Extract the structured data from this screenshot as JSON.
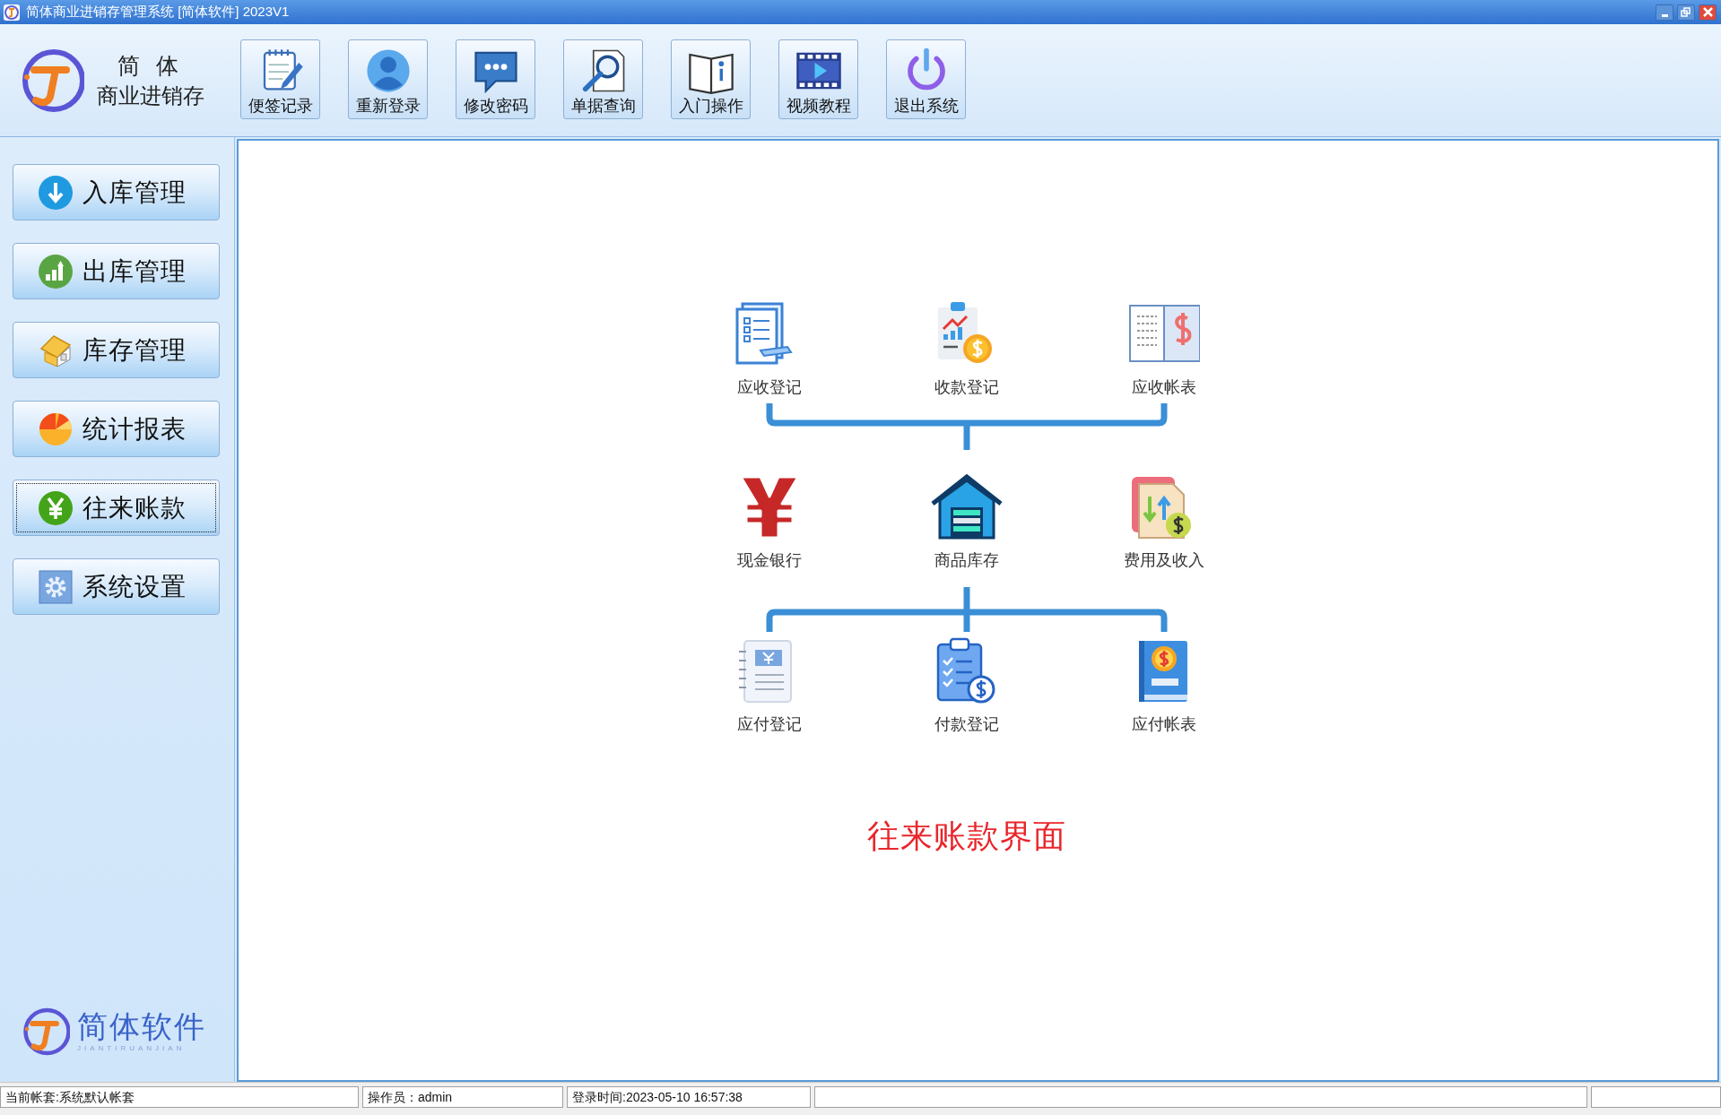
{
  "window": {
    "title": "简体商业进销存管理系统 [简体软件] 2023V1"
  },
  "brand": {
    "line_1": "简 体",
    "line_2": "商业进销存"
  },
  "toolbar": [
    {
      "label": "便签记录"
    },
    {
      "label": "重新登录"
    },
    {
      "label": "修改密码"
    },
    {
      "label": "单据查询"
    },
    {
      "label": "入门操作"
    },
    {
      "label": "视频教程"
    },
    {
      "label": "退出系统"
    }
  ],
  "sidebar": {
    "items": [
      {
        "label": "入库管理",
        "selected": false
      },
      {
        "label": "出库管理",
        "selected": false
      },
      {
        "label": "库存管理",
        "selected": false
      },
      {
        "label": "统计报表",
        "selected": false
      },
      {
        "label": "往来账款",
        "selected": true
      },
      {
        "label": "系统设置",
        "selected": false
      }
    ],
    "logo": {
      "name": "简体软件",
      "subtitle": "JIANTIRUANJIAN"
    }
  },
  "diagram": {
    "rows": [
      [
        {
          "label": "应收登记"
        },
        {
          "label": "收款登记"
        },
        {
          "label": "应收帐表"
        }
      ],
      [
        {
          "label": "现金银行"
        },
        {
          "label": "商品库存"
        },
        {
          "label": "费用及收入"
        }
      ],
      [
        {
          "label": "应付登记"
        },
        {
          "label": "付款登记"
        },
        {
          "label": "应付帐表"
        }
      ]
    ],
    "caption": "往来账款界面"
  },
  "status_bar": [
    {
      "text": "当前帐套:系统默认帐套"
    },
    {
      "text": "操作员：admin"
    },
    {
      "text": "登录时间:2023-05-10 16:57:38"
    }
  ]
}
